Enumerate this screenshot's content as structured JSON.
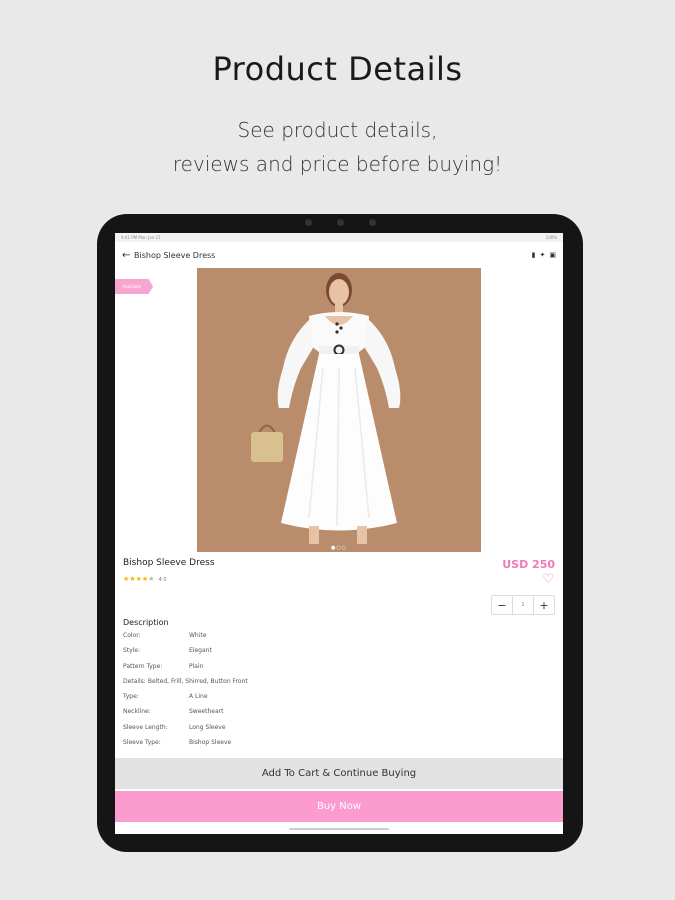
{
  "promo": {
    "title": "Product Details",
    "subtitle_line1": "See product details,",
    "subtitle_line2": "reviews and price before buying!"
  },
  "status_bar": {
    "left": "9:41 PM  Mon Jan 21",
    "right": "100%"
  },
  "app_bar": {
    "back_icon": "arrow-left-icon",
    "title": "Bishop Sleeve Dress",
    "actions": [
      "chat-icon",
      "share-icon",
      "cart-icon"
    ]
  },
  "gallery": {
    "badge": "Available",
    "dots": "●○○"
  },
  "product": {
    "name": "Bishop Sleeve Dress",
    "price": "USD 250",
    "rating": "4.0",
    "stars_filled": 4,
    "stars_total": 5,
    "quantity": "1"
  },
  "description": {
    "heading": "Description",
    "rows": [
      {
        "k": "Color:",
        "v": "White"
      },
      {
        "k": "Style:",
        "v": "Elegant"
      },
      {
        "k": "Pattern Type:",
        "v": "Plain"
      },
      {
        "k": "Details:",
        "v": "Belted, Frill, Shirred, Button Front"
      },
      {
        "k": "Type:",
        "v": "A Line"
      },
      {
        "k": "Neckline:",
        "v": "Sweetheart"
      },
      {
        "k": "Sleeve Length:",
        "v": "Long Sleeve"
      },
      {
        "k": "Sleeve Type:",
        "v": "Bishop Sleeve"
      }
    ]
  },
  "buttons": {
    "add_to_cart": "Add To Cart & Continue Buying",
    "buy_now": "Buy Now"
  },
  "colors": {
    "accent": "#f279b8",
    "buy_button": "#fc9bd0",
    "photo_bg": "#b98d6c"
  }
}
